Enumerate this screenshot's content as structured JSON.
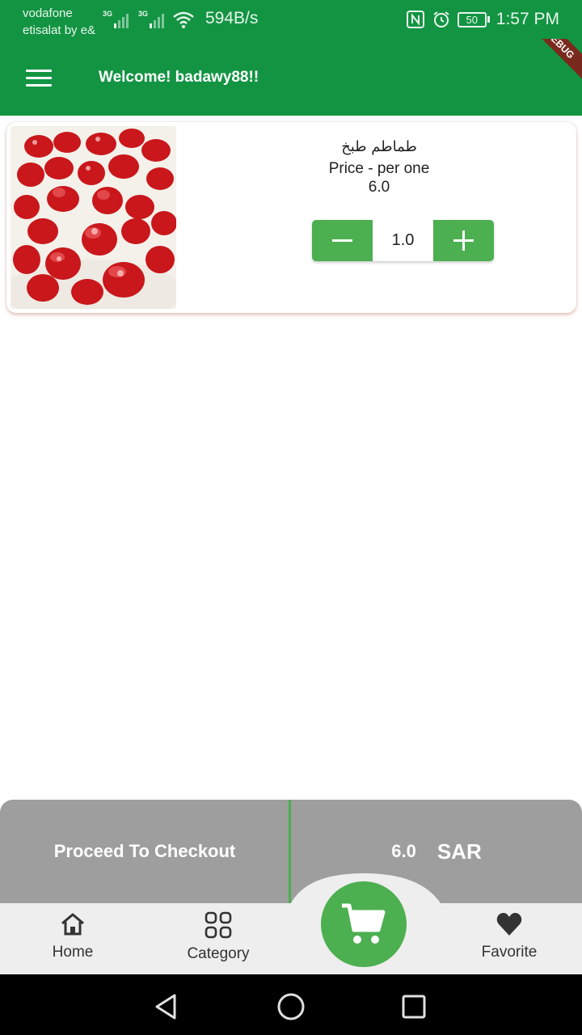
{
  "status_bar": {
    "carrier_1": "vodafone",
    "carrier_2": "etisalat by e&",
    "network_1": "3G",
    "network_2": "3G",
    "data_speed": "594B/s",
    "battery": "50",
    "time": "1:57 PM"
  },
  "app_bar": {
    "welcome": "Welcome! badawy88!!",
    "ribbon": "DEBUG",
    "color": "#139443"
  },
  "cart": {
    "items": [
      {
        "name": "طماطم طبخ",
        "price_label": "Price - per one",
        "price": "6.0",
        "quantity": "1.0"
      }
    ]
  },
  "checkout": {
    "button_label": "Proceed To Checkout",
    "total": "6.0",
    "currency": "SAR"
  },
  "bottom_nav": {
    "home": "Home",
    "category": "Category",
    "favorite": "Favorite"
  },
  "colors": {
    "primary_green": "#139443",
    "button_green": "#4caf50",
    "checkout_gray": "#9e9e9e"
  }
}
